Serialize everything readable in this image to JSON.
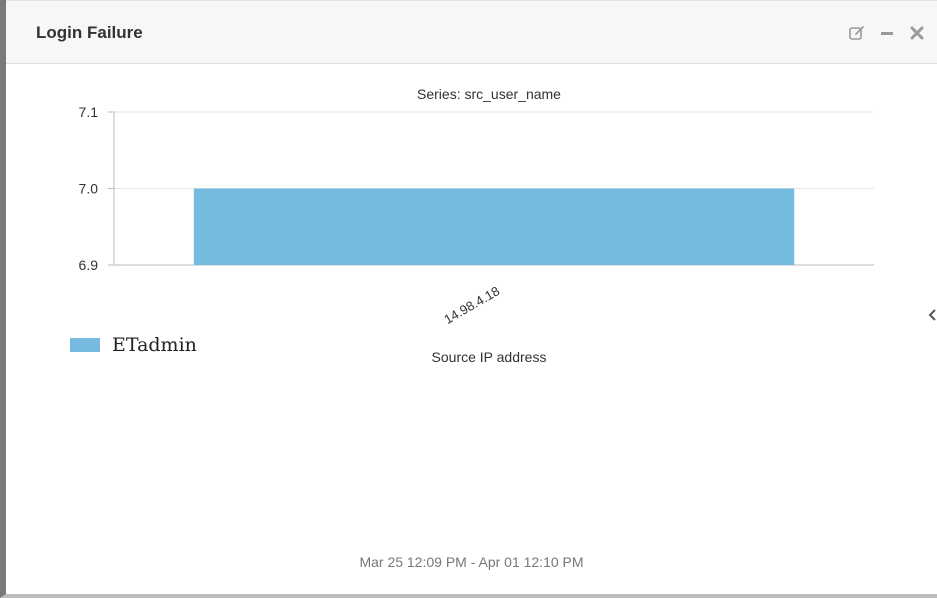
{
  "widget": {
    "title": "Login Failure",
    "date_range": "Mar 25 12:09 PM - Apr 01 12:10 PM"
  },
  "icons": {
    "edit": "edit-icon",
    "minimize": "minimize-icon",
    "close": "close-icon",
    "side_toggle": "chevron-left-icon"
  },
  "colors": {
    "bar": "#74bbdf",
    "icon": "#9a9a9a",
    "grid": "#e6e6e6",
    "axis": "#bdbdbd"
  },
  "chart_data": {
    "type": "bar",
    "title": "Series: src_user_name",
    "xlabel": "Source IP address",
    "ylabel": "",
    "categories": [
      "14.98.4.18"
    ],
    "series": [
      {
        "name": "ETadmin",
        "values": [
          7.0
        ]
      }
    ],
    "ylim": [
      6.9,
      7.1
    ],
    "yticks": [
      "6.9",
      "7.0",
      "7.1"
    ],
    "grid": true,
    "legend": "bottom-left"
  }
}
